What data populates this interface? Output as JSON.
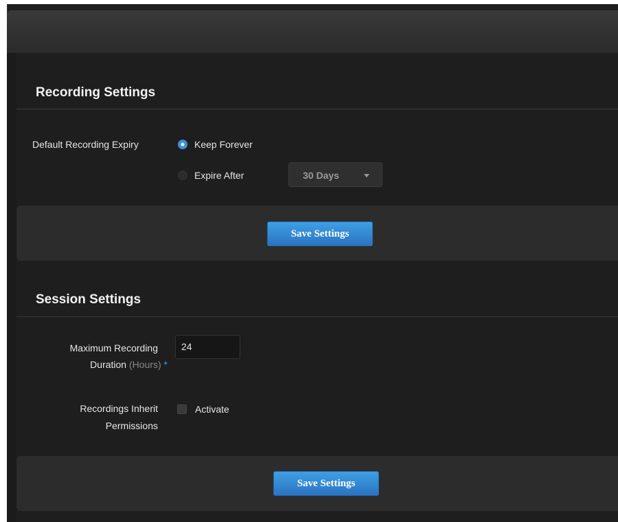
{
  "recording_settings": {
    "title": "Recording Settings",
    "expiry_label": "Default Recording Expiry",
    "options": [
      {
        "label": "Keep Forever",
        "checked": true
      },
      {
        "label": "Expire After",
        "checked": false
      }
    ],
    "expire_select": {
      "value": "30 Days"
    },
    "save_label": "Save Settings"
  },
  "session_settings": {
    "title": "Session Settings",
    "max_duration_label": "Maximum Recording",
    "max_duration_label_line2": "Duration",
    "max_duration_unit": "(Hours)",
    "required_mark": "*",
    "max_duration_value": "24",
    "inherit_label_line1": "Recordings Inherit",
    "inherit_label_line2": "Permissions",
    "activate_label": "Activate",
    "activate_checked": false,
    "save_label": "Save Settings"
  },
  "colors": {
    "accent": "#3b9ee6",
    "background": "#1e1e1e",
    "panel": "#2c2c2c"
  }
}
